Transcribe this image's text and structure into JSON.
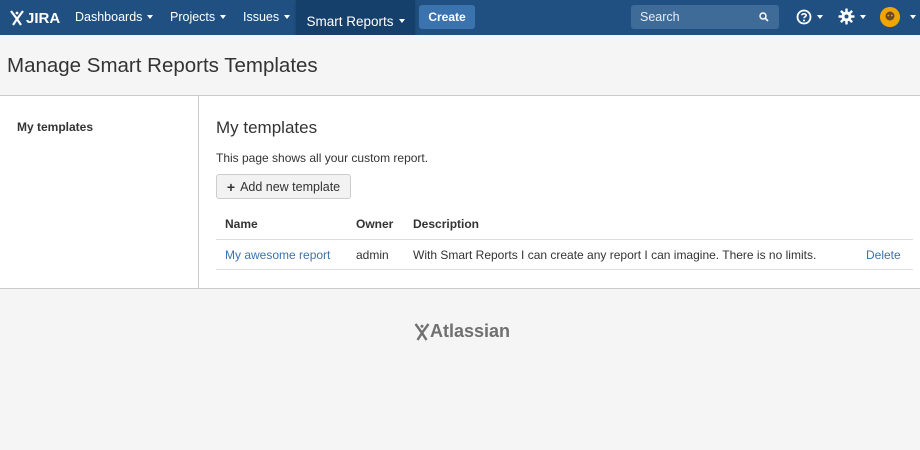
{
  "header": {
    "logo_text": "JIRA",
    "nav": [
      {
        "label": "Dashboards"
      },
      {
        "label": "Projects"
      },
      {
        "label": "Issues"
      }
    ],
    "active_nav": "Smart Reports",
    "create_label": "Create",
    "search_placeholder": "Search",
    "colors": {
      "bar": "#205081",
      "active": "#16406c",
      "create": "#3b73af"
    }
  },
  "page": {
    "title": "Manage Smart Reports Templates"
  },
  "sidebar": {
    "items": [
      {
        "label": "My templates"
      }
    ]
  },
  "main": {
    "heading": "My templates",
    "description": "This page shows all your custom report.",
    "add_button": "Add new template",
    "table": {
      "headers": [
        "Name",
        "Owner",
        "Description"
      ],
      "rows": [
        {
          "name": "My awesome report",
          "owner": "admin",
          "description": "With Smart Reports I can create any report I can imagine. There is no limits.",
          "action": "Delete"
        }
      ]
    }
  },
  "footer": {
    "logo_text": "Atlassian"
  }
}
